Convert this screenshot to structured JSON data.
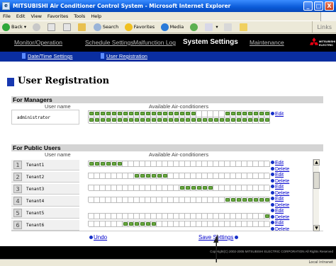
{
  "window": {
    "title": "MITSUBISHI Air Conditioner Control System - Microsoft Internet Explorer",
    "controls": [
      "_",
      "□",
      "X"
    ]
  },
  "menubar": [
    "File",
    "Edit",
    "View",
    "Favorites",
    "Tools",
    "Help"
  ],
  "toolbar": {
    "back": "Back",
    "search": "Search",
    "favorites": "Favorites",
    "media": "Media",
    "links": "Links"
  },
  "nav": {
    "items": [
      "Monitor/Operation",
      "Schedule Settings",
      "Malfunction Log",
      "System Settings",
      "Maintenance"
    ],
    "active": "System Settings",
    "logo_text": [
      "MITSUBISHI",
      "ELECTRIC"
    ]
  },
  "subnav": [
    "Date/Time Settings",
    "User Registration"
  ],
  "page_title": "User Registration",
  "managers": {
    "section": "For Managers",
    "col_user": "User name",
    "col_ac": "Available Air-conditioners",
    "rows": [
      {
        "name": "administrator",
        "edit": "Edit"
      }
    ]
  },
  "public": {
    "section": "For Public Users",
    "col_user": "User name",
    "col_ac": "Available Air-conditioners",
    "rows": [
      {
        "num": "1",
        "name": "Tenant1",
        "edit": "Edit",
        "delete": "Delete"
      },
      {
        "num": "2",
        "name": "Tenant2",
        "edit": "Edit",
        "delete": "Delete"
      },
      {
        "num": "3",
        "name": "Tenant3",
        "edit": "Edit",
        "delete": "Delete"
      },
      {
        "num": "4",
        "name": "Tenant4",
        "edit": "Edit",
        "delete": "Delete"
      },
      {
        "num": "5",
        "name": "Tenant5",
        "edit": "Edit",
        "delete": "Delete"
      },
      {
        "num": "6",
        "name": "Tenant6",
        "edit": "Edit",
        "delete": "Delete"
      }
    ]
  },
  "actions": {
    "undo": "Undo",
    "save": "Save Settings"
  },
  "footer": {
    "copyright": "Copyright(C) 2002-2005 MITSUBISHI ELECTRIC CORPORATION All Rights Reserved"
  },
  "status": {
    "zone": "Local intranet"
  }
}
